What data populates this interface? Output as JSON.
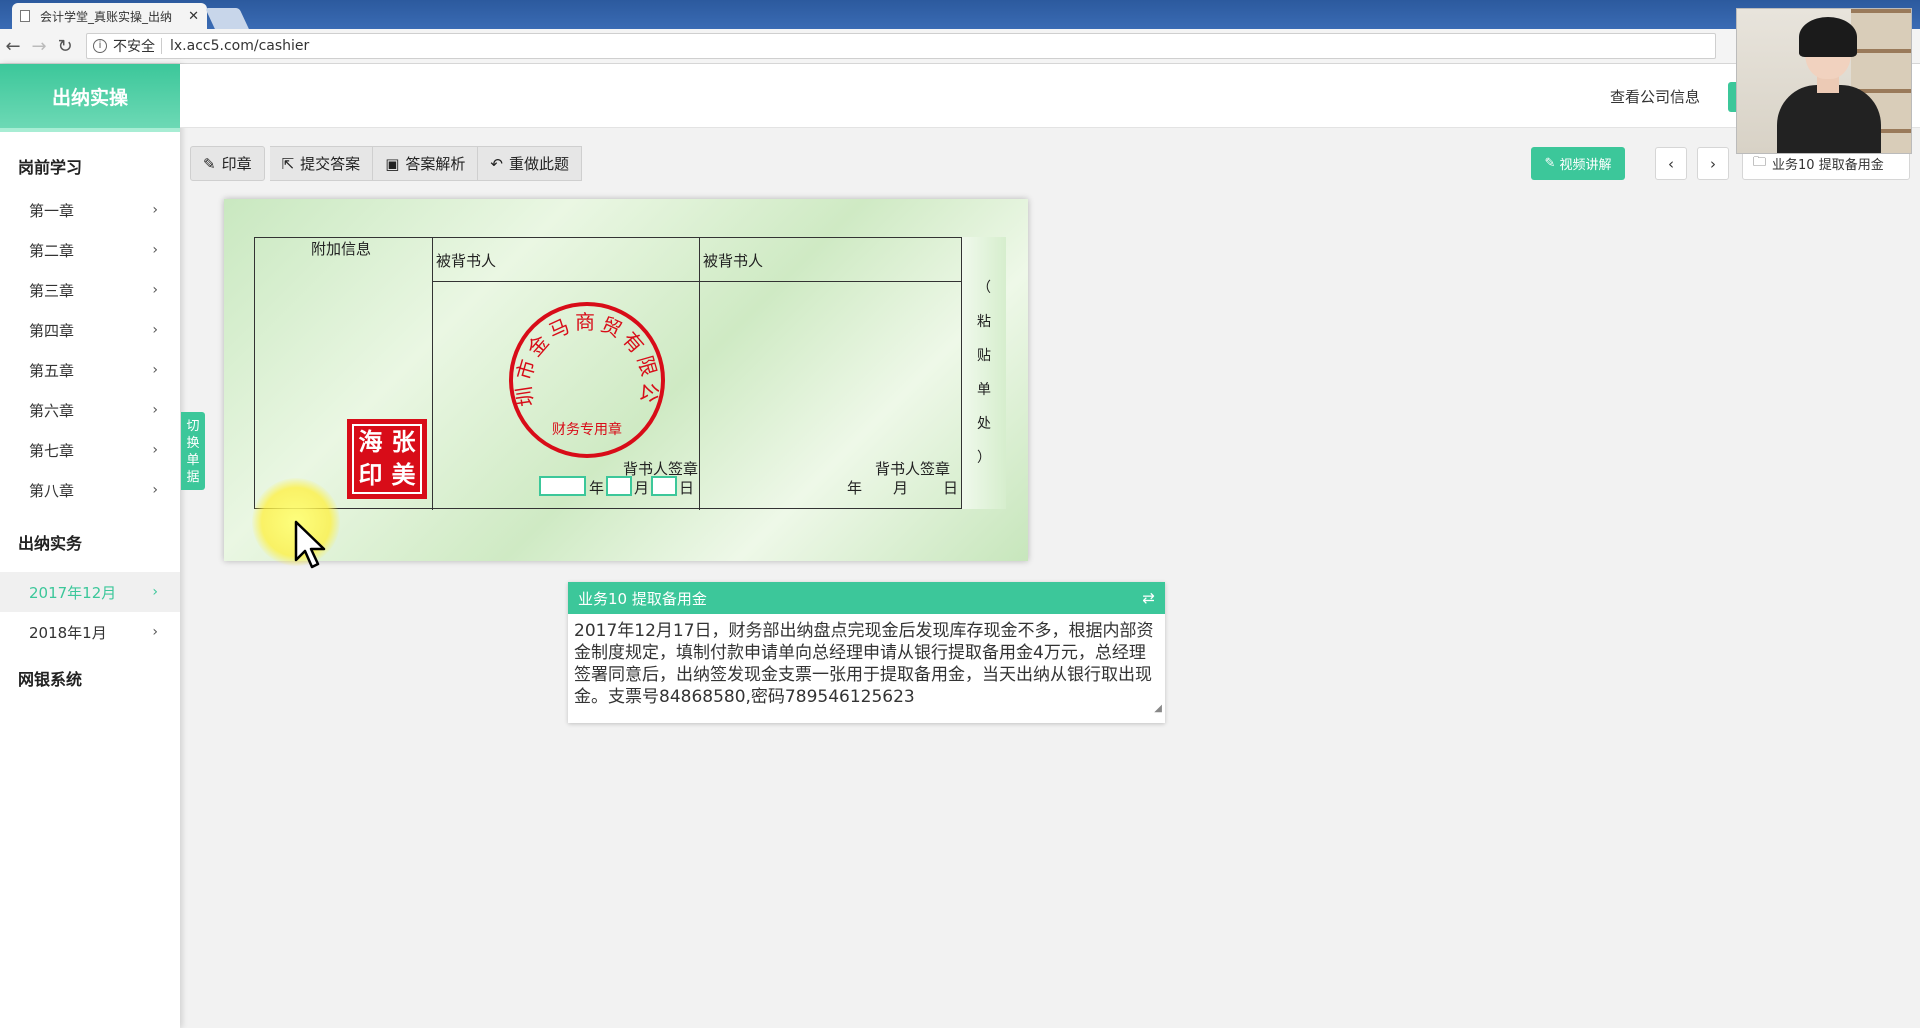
{
  "browser": {
    "tab_title": "会计学堂_真账实操_出纳",
    "security_label": "不安全",
    "url": "lx.acc5.com/cashier"
  },
  "sidebar": {
    "logo": "出纳实操",
    "sections": [
      {
        "title": "岗前学习",
        "items": [
          "第一章",
          "第二章",
          "第三章",
          "第四章",
          "第五章",
          "第六章",
          "第七章",
          "第八章"
        ]
      },
      {
        "title": "出纳实务",
        "items": [
          "2017年12月",
          "2018年1月"
        ]
      },
      {
        "title": "网银系统",
        "items": []
      }
    ],
    "active_item": "2017年12月",
    "switch_tab": "切换单据"
  },
  "header": {
    "company_info": "查看公司信息"
  },
  "toolbar": {
    "stamp": "印章",
    "submit": "提交答案",
    "analysis": "答案解析",
    "redo": "重做此题",
    "video": "视频讲解",
    "task_select": "业务10 提取备用金"
  },
  "cheque": {
    "extra_info": "附加信息",
    "endorsee_1": "被背书人",
    "endorsee_2": "被背书人",
    "endorser_sign_1": "背书人签章",
    "endorser_sign_2": "背书人签章",
    "year": "年",
    "month": "月",
    "day": "日",
    "paste_area": [
      "（",
      "粘",
      "贴",
      "单",
      "处",
      "）"
    ],
    "company_seal_text": "深圳市金马商贸有限公司",
    "company_seal_bottom": "财务专用章",
    "personal_seal": [
      "海",
      "张",
      "印",
      "美"
    ]
  },
  "task": {
    "title": "业务10 提取备用金",
    "description": "2017年12月17日，财务部出纳盘点完现金后发现库存现金不多，根据内部资金制度规定，填制付款申请单向总经理申请从银行提取备用金4万元，总经理签署同意后，出纳签发现金支票一张用于提取备用金，当天出纳从银行取出现金。支票号84868580,密码789546125623"
  },
  "colors": {
    "accent": "#3cc79a",
    "seal_red": "#d80c18"
  }
}
